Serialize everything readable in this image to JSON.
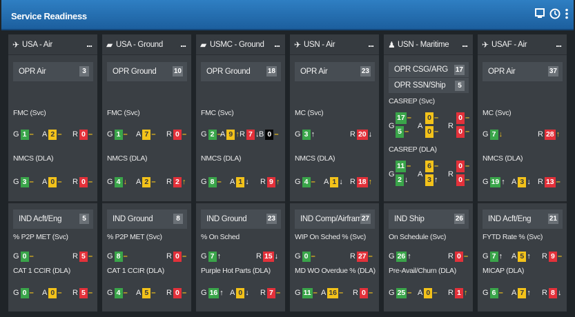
{
  "title": "Service Readiness",
  "title_icons": [
    "monitor-icon",
    "clock-icon",
    "kebab-menu-icon"
  ],
  "columns": [
    {
      "name": "USA - Air",
      "icon": "helicopter-icon",
      "menu": "...",
      "h1": {
        "label": "OPR Air",
        "count": "3"
      },
      "m1": {
        "label": "FMC (Svc)",
        "g": "1",
        "a": "2",
        "r": "0"
      },
      "m2": {
        "label": "NMCS (DLA)",
        "g": "3",
        "a": "0",
        "r": "0"
      },
      "h2": {
        "label": "IND Acft/Eng",
        "count": "5"
      },
      "m3": {
        "label": "% P2P MET (Svc)",
        "g": "0",
        "r": "5"
      },
      "m4": {
        "label": "CAT 1 CCIR (DLA)",
        "g": "0",
        "a": "0",
        "r": "5"
      }
    },
    {
      "name": "USA - Ground",
      "icon": "tank-icon",
      "menu": "...",
      "h1": {
        "label": "OPR Ground",
        "count": "10"
      },
      "m1": {
        "label": "FMC (Svc)",
        "g": "1",
        "a": "7",
        "r": "0"
      },
      "m2": {
        "label": "NMCS (DLA)",
        "g": "4",
        "a": "2",
        "r": "2"
      },
      "h2": {
        "label": "IND Ground",
        "count": "8"
      },
      "m3": {
        "label": "% P2P MET (Svc)",
        "g": "8",
        "r": "0"
      },
      "m4": {
        "label": "CAT 1 CCIR (DLA)",
        "g": "4",
        "a": "5",
        "r": "0"
      }
    },
    {
      "name": "USMC - Ground",
      "icon": "tank-icon",
      "menu": "...",
      "h1": {
        "label": "OPR Ground",
        "count": "18"
      },
      "m1": {
        "label": "FMC (Svc)",
        "g": "2",
        "a": "9",
        "r": "7",
        "b_label": "B",
        "b": "0"
      },
      "m2": {
        "label": "NMCS (DLA)",
        "g": "8",
        "a": "1",
        "r": "9"
      },
      "h2": {
        "label": "IND Ground",
        "count": "23"
      },
      "m3": {
        "label": "% On Sched",
        "g": "7",
        "r": "15"
      },
      "m4": {
        "label": "Purple Hot Parts (DLA)",
        "g": "16",
        "a": "0",
        "r": "7"
      }
    },
    {
      "name": "USN - Air",
      "icon": "airplane-icon",
      "menu": "...",
      "h1": {
        "label": "OPR Air",
        "count": "23"
      },
      "m1": {
        "label": "MC (Svc)",
        "g": "3",
        "r": "20"
      },
      "m2": {
        "label": "NMCS (DLA)",
        "g": "4",
        "a": "1",
        "r": "18"
      },
      "h2": {
        "label": "IND Comp/Airframes",
        "count": "27"
      },
      "m3": {
        "label": "WIP On Sched % (Svc)",
        "g": "0",
        "r": "27"
      },
      "m4": {
        "label": "MD WO Overdue % (DLA)",
        "g": "11",
        "a": "16",
        "r": "0"
      }
    },
    {
      "name": "USN - Maritime",
      "icon": "person-icon",
      "menu": "...",
      "h1": {
        "label": "OPR CSG/ARG",
        "count": "17"
      },
      "h1b": {
        "label": "OPR SSN/Ship",
        "count": "5"
      },
      "m1": {
        "label": "CASREP (Svc)",
        "g_top": "17",
        "g_bot": "5",
        "a_top": "0",
        "a_bot": "0",
        "r_top": "0",
        "r_bot": "0"
      },
      "m2": {
        "label": "CASREP (DLA)",
        "g_top": "11",
        "g_bot": "2",
        "a_top": "6",
        "a_bot": "3",
        "r_top": "0",
        "r_bot": "0"
      },
      "h2": {
        "label": "IND Ship",
        "count": "26"
      },
      "m3": {
        "label": "On Schedule (Svc)",
        "g": "26",
        "r": "0"
      },
      "m4": {
        "label": "Pre-Avail/Churn (DLA)",
        "g": "25",
        "a": "0",
        "r": "1"
      }
    },
    {
      "name": "USAF - Air",
      "icon": "airplane-icon",
      "menu": "...",
      "h1": {
        "label": "OPR Air",
        "count": "37"
      },
      "m1": {
        "label": "MC (Svc)",
        "g": "7",
        "r": "28"
      },
      "m2": {
        "label": "NMCS (DLA)",
        "g": "19",
        "a": "3",
        "r": "13"
      },
      "h2": {
        "label": "IND Acft/Eng",
        "count": "21"
      },
      "m3": {
        "label": "FYTD Rate % (Svc)",
        "g": "7",
        "a": "5",
        "r": "9"
      },
      "m4": {
        "label": "MICAP (DLA)",
        "g": "6",
        "a": "7",
        "r": "8"
      }
    }
  ],
  "letters": {
    "g": "G",
    "a": "A",
    "r": "R"
  },
  "colors": {
    "green": "#3aa54a",
    "amber": "#f3c21a",
    "red": "#e3313a",
    "titlebar": "#2577b8"
  }
}
